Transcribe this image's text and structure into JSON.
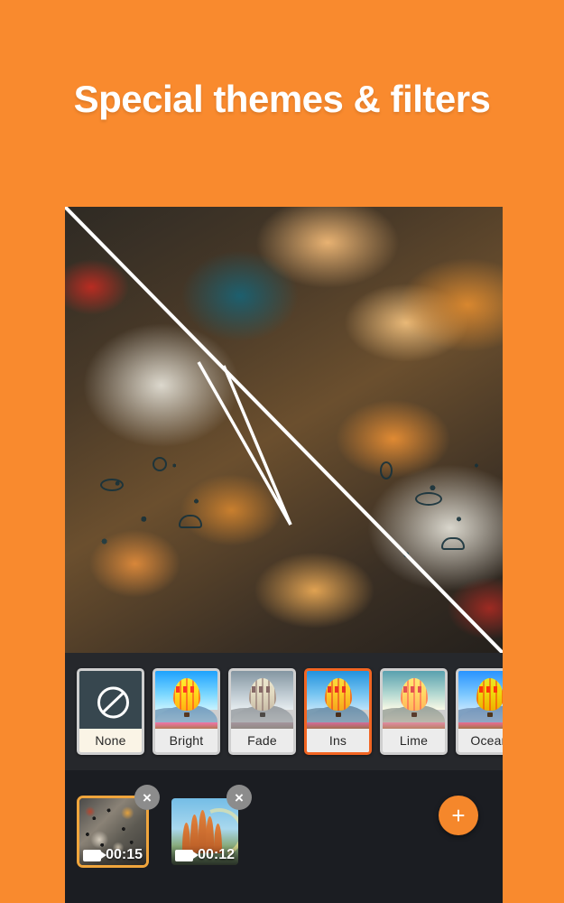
{
  "promo": {
    "headline": "Special themes & filters",
    "background_color": "#F98A2E"
  },
  "editor": {
    "panel_color": "#1b1d22",
    "accent_color": "#F26522",
    "preview": {
      "subject": "fast-food-flatlay-photo",
      "compare_split": "diagonal-white-line"
    },
    "filter_strip": {
      "selected": "Ins",
      "filters": [
        {
          "label": "None",
          "icon": "no-filter-icon",
          "selected": false
        },
        {
          "label": "Bright",
          "icon": "balloon-thumb",
          "selected": false
        },
        {
          "label": "Fade",
          "icon": "balloon-thumb",
          "selected": false
        },
        {
          "label": "Ins",
          "icon": "balloon-thumb",
          "selected": true
        },
        {
          "label": "Lime",
          "icon": "balloon-thumb",
          "selected": false
        },
        {
          "label": "Ocean",
          "icon": "balloon-thumb",
          "selected": false
        }
      ]
    },
    "timeline": {
      "add_label": "+",
      "close_label": "×",
      "clips": [
        {
          "duration": "00:15",
          "selected": true,
          "art": "doodle-wrapper-food"
        },
        {
          "duration": "00:12",
          "selected": false,
          "art": "sagrada-familia"
        }
      ]
    }
  }
}
